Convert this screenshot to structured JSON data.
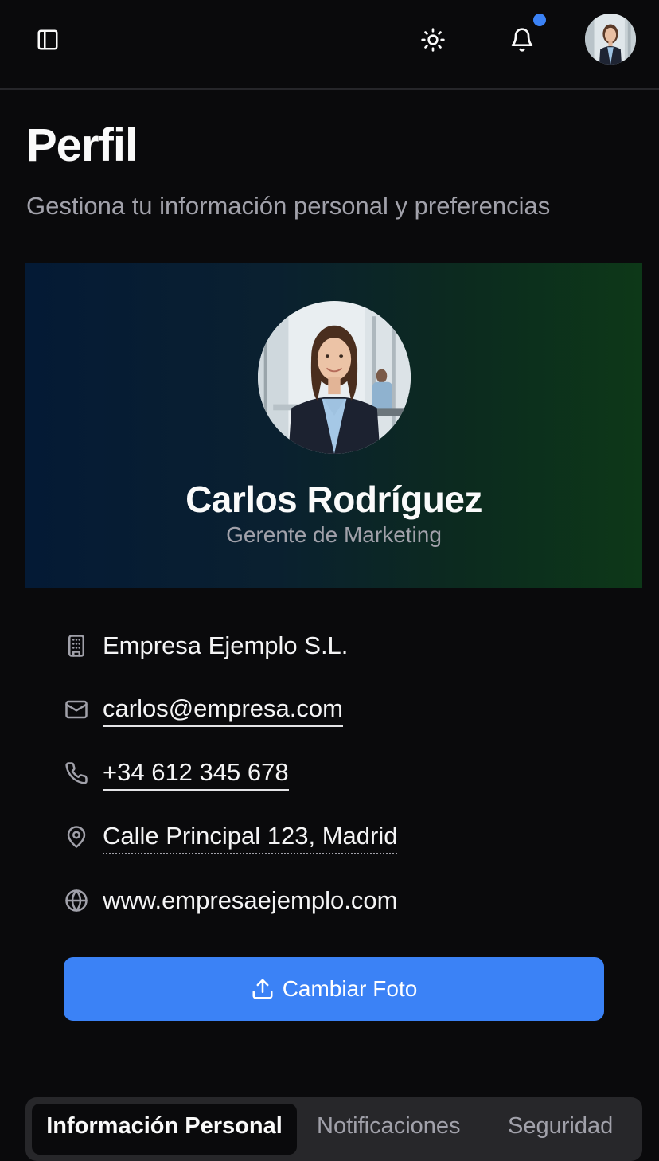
{
  "header": {
    "icons": [
      "sidebar-toggle-icon",
      "sun-icon",
      "bell-icon"
    ],
    "notification_dot_color": "#3b82f6"
  },
  "page": {
    "title": "Perfil",
    "subtitle": "Gestiona tu información personal y preferencias"
  },
  "profile": {
    "name": "Carlos Rodríguez",
    "role": "Gerente de Marketing",
    "company": "Empresa Ejemplo S.L.",
    "email": "carlos@empresa.com",
    "phone": "+34 612 345 678",
    "address": "Calle Principal 123, Madrid",
    "website": "www.empresaejemplo.com"
  },
  "actions": {
    "change_photo_label": "Cambiar Foto"
  },
  "tabs": [
    {
      "label": "Información Personal",
      "active": true
    },
    {
      "label": "Notificaciones",
      "active": false
    },
    {
      "label": "Seguridad",
      "active": false
    }
  ],
  "colors": {
    "accent": "#3b82f6",
    "background": "#0a0a0c",
    "muted_text": "#a1a1aa"
  }
}
